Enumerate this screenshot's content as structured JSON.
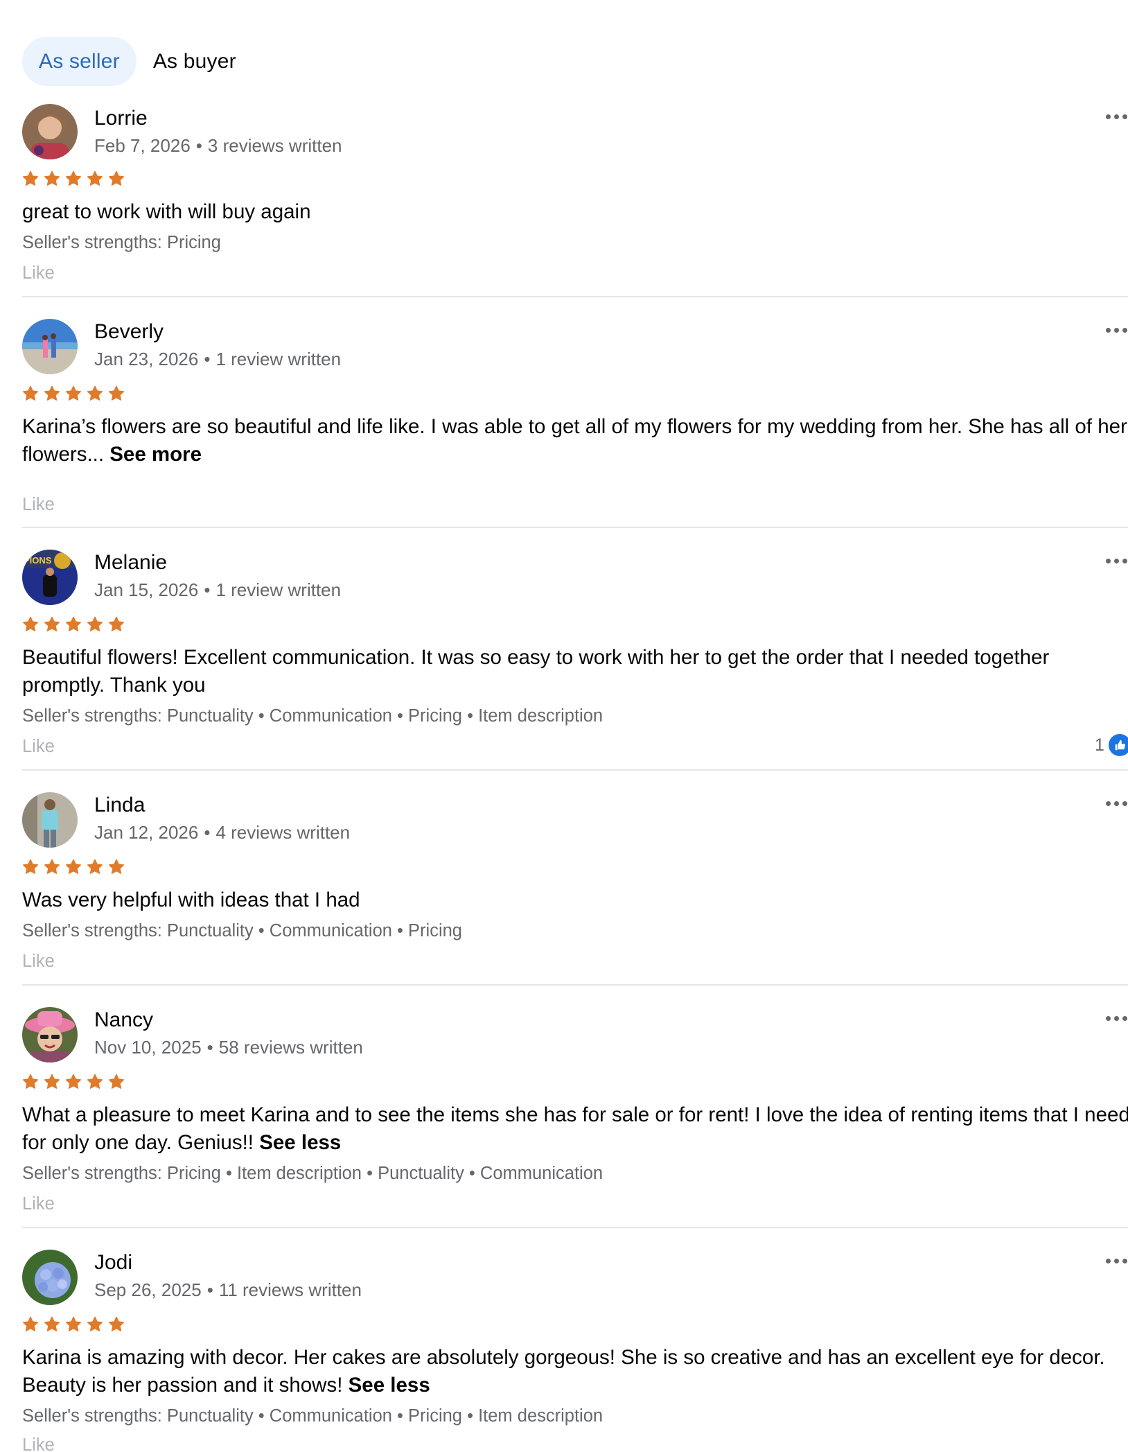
{
  "tabs": [
    {
      "label": "As seller",
      "active": true
    },
    {
      "label": "As buyer",
      "active": false
    }
  ],
  "colors": {
    "star": "#e07b2a",
    "active_tab_bg": "#ebf3fe",
    "active_tab_text": "#2a6bb8",
    "like_text": "#b0b3b8",
    "meta_text": "#65676b"
  },
  "reviews": [
    {
      "name": "Lorrie",
      "date": "Feb 7, 2026",
      "reviews_written": "3 reviews written",
      "rating": 5,
      "text": "great to work with will buy again",
      "toggle": "",
      "strengths": "Seller's strengths: Pricing",
      "like": "Like",
      "reaction_count": ""
    },
    {
      "name": "Beverly",
      "date": "Jan 23, 2026",
      "reviews_written": "1 review written",
      "rating": 5,
      "text": "Karina’s flowers are so beautiful and life like. I was able to get all of my flowers for my wedding from her. She has all of her flowers...",
      "toggle": "See more",
      "strengths": "",
      "like": "Like",
      "reaction_count": ""
    },
    {
      "name": "Melanie",
      "date": "Jan 15, 2026",
      "reviews_written": "1 review written",
      "rating": 5,
      "text": "Beautiful flowers! Excellent communication. It was so easy to work with her to get the order that I needed together promptly. Thank you",
      "toggle": "",
      "strengths": "Seller's strengths: Punctuality • Communication • Pricing • Item description",
      "like": "Like",
      "reaction_count": "1"
    },
    {
      "name": "Linda",
      "date": "Jan 12, 2026",
      "reviews_written": "4 reviews written",
      "rating": 5,
      "text": "Was very helpful with ideas that I had",
      "toggle": "",
      "strengths": "Seller's strengths: Punctuality • Communication • Pricing",
      "like": "Like",
      "reaction_count": ""
    },
    {
      "name": "Nancy",
      "date": "Nov 10, 2025",
      "reviews_written": "58 reviews written",
      "rating": 5,
      "text": "What a pleasure to meet Karina and to see the items she has for sale or for rent!  I love the idea of renting items that I need for only one day.  Genius!!",
      "toggle": "See less",
      "strengths": "Seller's strengths: Pricing • Item description • Punctuality • Communication",
      "like": "Like",
      "reaction_count": ""
    },
    {
      "name": "Jodi",
      "date": "Sep 26, 2025",
      "reviews_written": "11 reviews written",
      "rating": 5,
      "text": "Karina is amazing with decor. Her cakes are absolutely gorgeous! She is so creative and has an excellent eye for decor. Beauty is her passion and it shows!",
      "toggle": "See less",
      "strengths": "Seller's strengths: Punctuality • Communication • Pricing • Item description",
      "like": "Like",
      "reaction_count": ""
    }
  ]
}
